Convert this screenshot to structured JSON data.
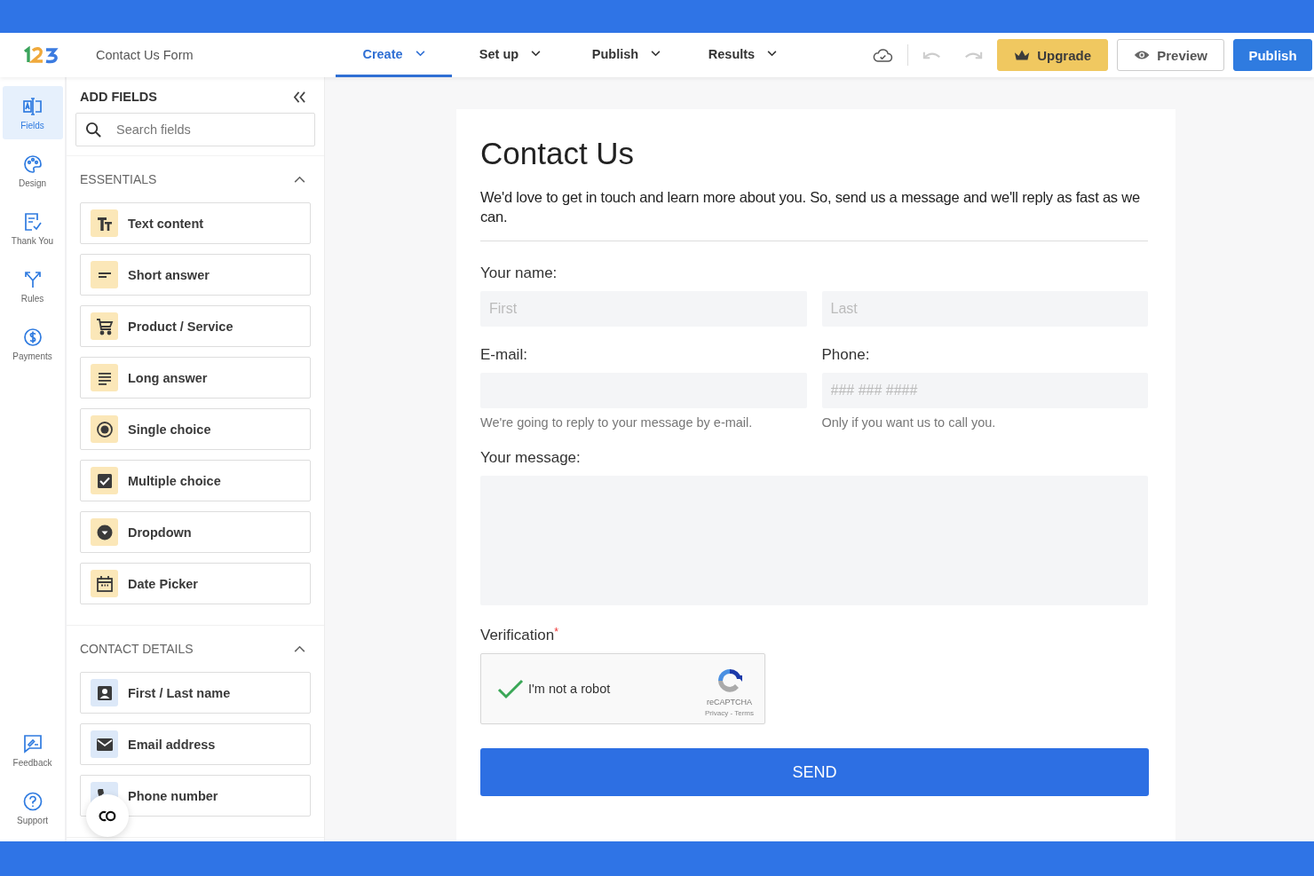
{
  "header": {
    "form_name": "Contact Us Form",
    "tabs": [
      {
        "label": "Create",
        "selected": true
      },
      {
        "label": "Set up",
        "selected": false
      },
      {
        "label": "Publish",
        "selected": false
      },
      {
        "label": "Results",
        "selected": false
      }
    ],
    "buttons": [
      {
        "label": "Upgrade",
        "kind": "upgrade"
      },
      {
        "label": "Preview",
        "kind": "preview"
      },
      {
        "label": "Publish",
        "kind": "primary"
      }
    ]
  },
  "rail": {
    "items": [
      {
        "label": "Fields",
        "kind": "fields",
        "selected": true
      },
      {
        "label": "Design",
        "kind": "design",
        "selected": false
      },
      {
        "label": "Thank You",
        "kind": "thanks",
        "selected": false
      },
      {
        "label": "Rules",
        "kind": "rules",
        "selected": false
      },
      {
        "label": "Payments",
        "kind": "payments",
        "selected": false
      }
    ],
    "bottom_items": [
      {
        "label": "Feedback",
        "kind": "feedback",
        "selected": false
      },
      {
        "label": "Support",
        "kind": "support",
        "selected": false
      }
    ]
  },
  "panel": {
    "title": "ADD FIELDS",
    "search": {
      "placeholder": "Search fields"
    },
    "sections": [
      {
        "title": "ESSENTIALS",
        "expanded": true,
        "color": "#fbe7b8",
        "items": [
          {
            "label": "Text content",
            "kind": "text"
          },
          {
            "label": "Short answer",
            "kind": "short"
          },
          {
            "label": "Product / Service",
            "kind": "cart"
          },
          {
            "label": "Long answer",
            "kind": "long"
          },
          {
            "label": "Single choice",
            "kind": "radio"
          },
          {
            "label": "Multiple choice",
            "kind": "checkbox"
          },
          {
            "label": "Dropdown",
            "kind": "dropdown"
          },
          {
            "label": "Date Picker",
            "kind": "date"
          }
        ]
      },
      {
        "title": "CONTACT DETAILS",
        "expanded": true,
        "color": "#dce8f8",
        "items": [
          {
            "label": "First / Last name",
            "kind": "person"
          },
          {
            "label": "Email address",
            "kind": "mail"
          },
          {
            "label": "Phone number",
            "kind": "phone"
          }
        ]
      }
    ]
  },
  "form": {
    "title": "Contact Us",
    "intro": "We'd love to get in touch and learn more about you. So, send us a message and we'll reply as fast as we can.",
    "rows": [
      {
        "fields": [
          {
            "label": "Your name:",
            "kind": "name",
            "inputs": [
              {
                "placeholder": "First"
              },
              {
                "placeholder": "Last"
              }
            ]
          }
        ]
      },
      {
        "fields": [
          {
            "label": "E-mail:",
            "kind": "text",
            "hint": "We're going to reply to your message by e-mail."
          },
          {
            "label": "Phone:",
            "kind": "text",
            "placeholder": "### ### ####",
            "hint": "Only if you want us to call you."
          }
        ]
      },
      {
        "fields": [
          {
            "label": "Your message:",
            "kind": "textarea"
          }
        ]
      }
    ],
    "verification": {
      "label": "Verification",
      "required_mark": "*",
      "checked": true,
      "text": "I'm not a robot",
      "brand": "reCAPTCHA",
      "links": "Privacy - Terms"
    },
    "submit": "SEND"
  }
}
